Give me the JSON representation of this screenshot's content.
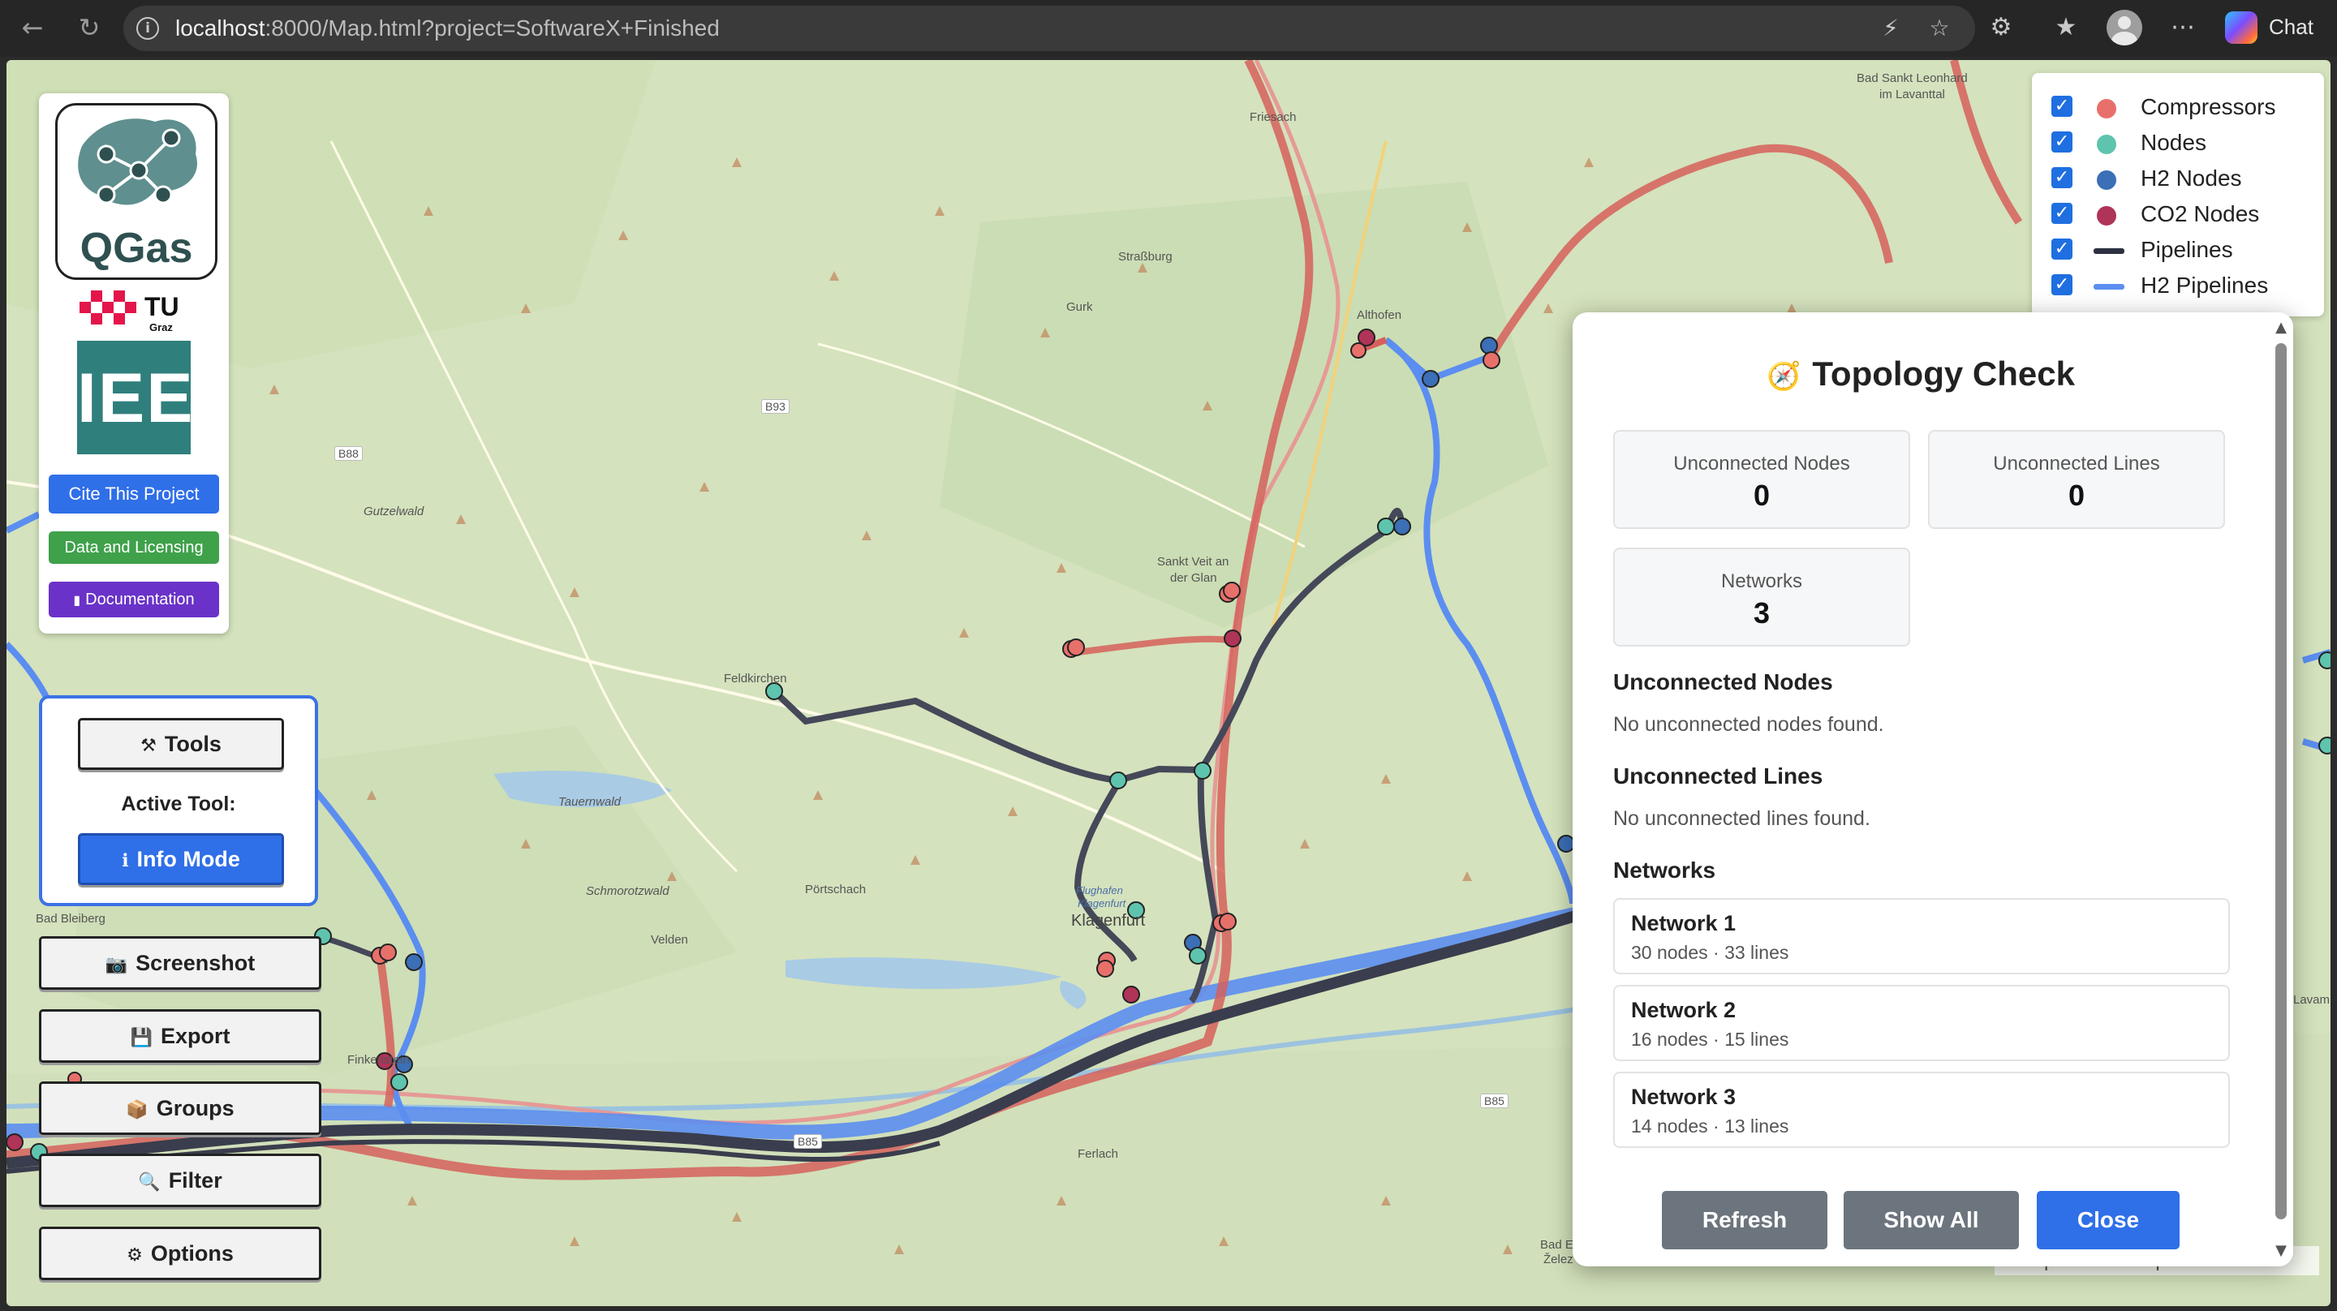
{
  "browser": {
    "url_host": "localhost",
    "url_rest": ":8000/Map.html?project=SoftwareX+Finished",
    "chat_label": "Chat"
  },
  "branding": {
    "qgas_text": "QGas",
    "tu_text": "TU",
    "tu_sub": "Graz",
    "iee_text": "IEE"
  },
  "left_buttons": {
    "cite": "Cite This Project",
    "data": "Data and Licensing",
    "doc": "Documentation"
  },
  "tools": {
    "tools_label": "Tools",
    "active_tool_label": "Active Tool:",
    "info_mode_label": "Info Mode"
  },
  "side_buttons": {
    "screenshot": "Screenshot",
    "export": "Export",
    "groups": "Groups",
    "filter": "Filter",
    "options": "Options"
  },
  "legend": {
    "items": [
      {
        "label": "Compressors",
        "color": "#e8706a",
        "kind": "dot"
      },
      {
        "label": "Nodes",
        "color": "#5ec4ae",
        "kind": "dot"
      },
      {
        "label": "H2 Nodes",
        "color": "#3b6fb6",
        "kind": "dot"
      },
      {
        "label": "CO2 Nodes",
        "color": "#b03358",
        "kind": "dot"
      },
      {
        "label": "Pipelines",
        "color": "#2c3040",
        "kind": "line"
      },
      {
        "label": "H2 Pipelines",
        "color": "#5b8ef0",
        "kind": "line"
      }
    ]
  },
  "map": {
    "attribution": "© OpenStreetMap Contributors",
    "towns": [
      "Bad Sankt Leonhard",
      "im Lavanttal",
      "Friesach",
      "Straßburg",
      "Gurk",
      "Althofen",
      "Sankt Veit an",
      "der Glan",
      "Feldkirchen",
      "Gutzelwald",
      "Tauernwald",
      "Schmorotzwald",
      "Pörtschach",
      "Velden",
      "Klagenfurt",
      "Flughafen",
      "Klagenfurt",
      "Bad Bleiberg",
      "Ferlach",
      "Bad E",
      "Želez",
      "Finkenstein",
      "Lavamünd"
    ],
    "roads": [
      "B93",
      "B88",
      "B85",
      "B85"
    ]
  },
  "topology": {
    "title": "Topology Check",
    "stats": [
      {
        "label": "Unconnected Nodes",
        "value": "0"
      },
      {
        "label": "Unconnected Lines",
        "value": "0"
      },
      {
        "label": "Networks",
        "value": "3"
      }
    ],
    "unconnected_nodes_heading": "Unconnected Nodes",
    "unconnected_nodes_text": "No unconnected nodes found.",
    "unconnected_lines_heading": "Unconnected Lines",
    "unconnected_lines_text": "No unconnected lines found.",
    "networks_heading": "Networks",
    "networks": [
      {
        "name": "Network 1",
        "meta": "30 nodes · 33 lines"
      },
      {
        "name": "Network 2",
        "meta": "16 nodes · 15 lines"
      },
      {
        "name": "Network 3",
        "meta": "14 nodes · 13 lines"
      }
    ],
    "buttons": {
      "refresh": "Refresh",
      "show_all": "Show All",
      "close": "Close"
    }
  }
}
